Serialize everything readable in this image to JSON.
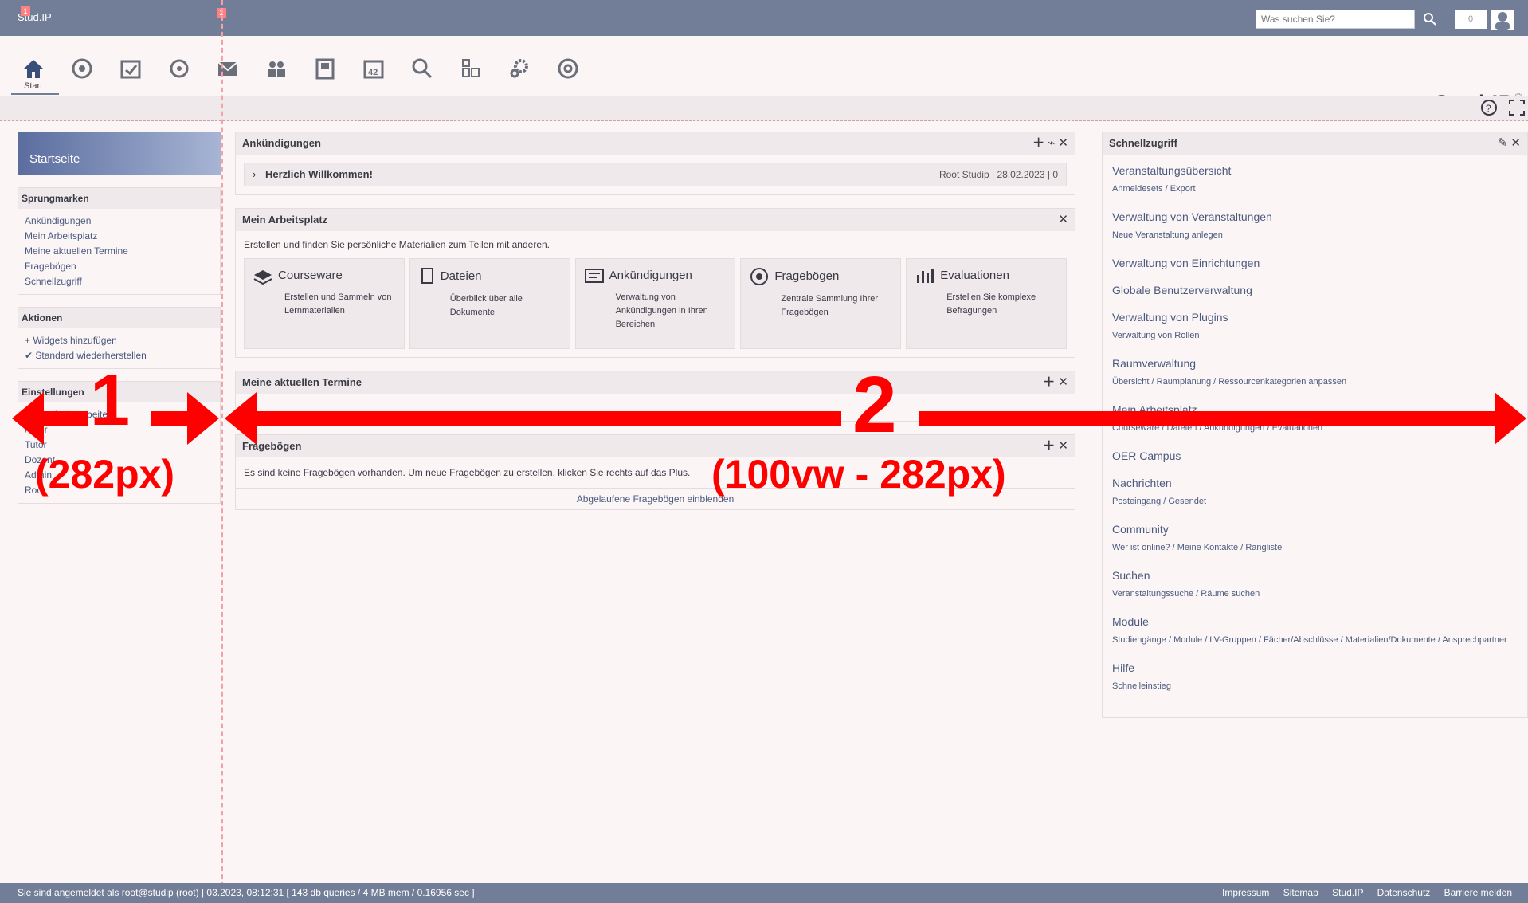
{
  "top": {
    "brand": "Stud.IP",
    "search_placeholder": "Was suchen Sie?",
    "notifications": "0",
    "markers": [
      "1",
      "2"
    ]
  },
  "nav": {
    "start_label": "Start",
    "items": [
      "home",
      "courses",
      "admin",
      "spaces",
      "mail",
      "community",
      "profile",
      "calendar",
      "search",
      "tools",
      "settings",
      "help"
    ],
    "logo": "Stud.IP"
  },
  "sidebar": {
    "title": "Startseite",
    "sections": [
      {
        "title": "Sprungmarken",
        "items": [
          "Ankündigungen",
          "Mein Arbeitsplatz",
          "Meine aktuellen Termine",
          "Fragebögen",
          "Schnellzugriff"
        ]
      },
      {
        "title": "Aktionen",
        "items": [
          "+ Widgets hinzufügen",
          "✔ Standard wiederherstellen"
        ]
      },
      {
        "title": "Einstellungen",
        "items": [
          "Startseite bearbeiten",
          "Autor",
          "Tutor",
          "Dozent",
          "Admin",
          "Root"
        ]
      }
    ]
  },
  "widgets": {
    "announcements": {
      "title": "Ankündigungen",
      "row_title": "Herzlich Willkommen!",
      "author": "Root Studip",
      "date": "28.02.2023",
      "count": "0"
    },
    "workspace": {
      "title": "Mein Arbeitsplatz",
      "intro": "Erstellen und finden Sie persönliche Materialien zum Teilen mit anderen.",
      "tiles": [
        {
          "title": "Courseware",
          "desc": "Erstellen und Sammeln von Lernmaterialien"
        },
        {
          "title": "Dateien",
          "desc": "Überblick über alle Dokumente"
        },
        {
          "title": "Ankündigungen",
          "desc": "Verwaltung von Ankündigungen in Ihren Bereichen"
        },
        {
          "title": "Fragebögen",
          "desc": "Zentrale Sammlung Ihrer Fragebögen"
        },
        {
          "title": "Evaluationen",
          "desc": "Erstellen Sie komplexe Befragungen"
        }
      ]
    },
    "termine": {
      "title": "Meine aktuellen Termine"
    },
    "fragebogen": {
      "title": "Fragebögen",
      "empty": "Es sind keine Fragebögen vorhanden. Um neue Fragebögen zu erstellen, klicken Sie rechts auf das Plus.",
      "link": "Abgelaufene Fragebögen einblenden"
    }
  },
  "quick": {
    "title": "Schnellzugriff",
    "items": [
      {
        "title": "Veranstaltungsübersicht",
        "sub": "Anmeldesets / Export"
      },
      {
        "title": "Verwaltung von Veranstaltungen",
        "sub": "Neue Veranstaltung anlegen"
      },
      {
        "title": "Verwaltung von Einrichtungen",
        "sub": ""
      },
      {
        "title": "Globale Benutzerverwaltung",
        "sub": ""
      },
      {
        "title": "Verwaltung von Plugins",
        "sub": "Verwaltung von Rollen"
      },
      {
        "title": "Raumverwaltung",
        "sub": "Übersicht / Raumplanung / Ressourcenkategorien anpassen"
      },
      {
        "title": "Mein Arbeitsplatz",
        "sub": "Courseware / Dateien / Ankündigungen / Evaluationen"
      },
      {
        "title": "OER Campus",
        "sub": ""
      },
      {
        "title": "Nachrichten",
        "sub": "Posteingang / Gesendet"
      },
      {
        "title": "Community",
        "sub": "Wer ist online? / Meine Kontakte / Rangliste"
      },
      {
        "title": "Suchen",
        "sub": "Veranstaltungssuche / Räume suchen"
      },
      {
        "title": "Module",
        "sub": "Studiengänge / Module / LV-Gruppen / Fächer/Abschlüsse / Materialien/Dokumente / Ansprechpartner"
      },
      {
        "title": "Hilfe",
        "sub": "Schnelleinstieg"
      }
    ]
  },
  "annotation": {
    "label1": "1",
    "size1": "(282px)",
    "label2": "2",
    "size2": "(100vw - 282px)",
    "color": "#ff0000"
  },
  "footer": {
    "left": "Sie sind angemeldet als root@studip (root) | 03.2023, 08:12:31 [ 143 db queries / 4 MB mem / 0.16956 sec ]",
    "links": [
      "Impressum",
      "Sitemap",
      "Stud.IP",
      "Datenschutz",
      "Barriere melden"
    ]
  }
}
